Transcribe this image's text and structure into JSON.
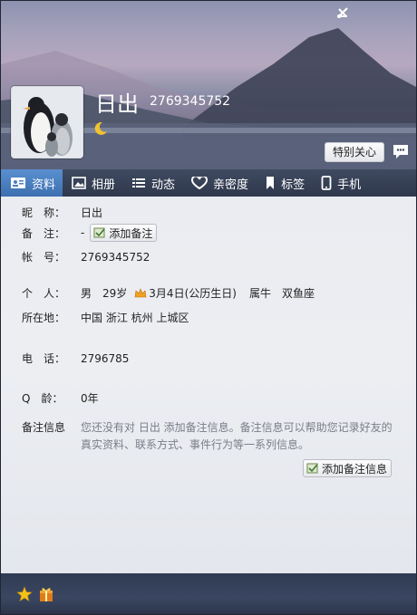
{
  "window": {
    "controls": [
      "skin-icon",
      "minimize-icon",
      "close-icon"
    ]
  },
  "profile": {
    "nickname": "日出",
    "qq_number": "2769345752",
    "special_care_label": "特别关心"
  },
  "tabs": [
    {
      "label": "资料",
      "icon": "profile-card-icon",
      "active": true
    },
    {
      "label": "相册",
      "icon": "album-icon",
      "active": false
    },
    {
      "label": "动态",
      "icon": "feed-icon",
      "active": false
    },
    {
      "label": "亲密度",
      "icon": "heart-icon",
      "active": false
    },
    {
      "label": "标签",
      "icon": "bookmark-icon",
      "active": false
    },
    {
      "label": "手机",
      "icon": "phone-icon",
      "active": false
    }
  ],
  "info": {
    "nickname_label": "昵　称：",
    "nickname_value": "日出",
    "remark_label": "备　注：",
    "remark_value": "-",
    "add_remark_btn": "添加备注",
    "account_label": "帐　号：",
    "account_value": "2769345752",
    "personal_label": "个　人：",
    "gender": "男",
    "age": "29岁",
    "birthday": "3月4日(公历生日)",
    "zodiac": "属牛",
    "constellation": "双鱼座",
    "location_label": "所在地：",
    "location_value": "中国 浙江 杭州 上城区",
    "phone_label": "电　话：",
    "phone_value": "2796785",
    "qage_label": "Q　龄：",
    "qage_value": "0年",
    "note_label": "备注信息",
    "note_desc": "您还没有对 日出 添加备注信息。备注信息可以帮助您记录好友的真实资料、联系方式、事件行为等一系列信息。",
    "add_note_btn": "添加备注信息"
  },
  "colors": {
    "tab_active": "#4a80c2",
    "tab_bar": "#353f54",
    "note_text": "#7a7e88"
  }
}
